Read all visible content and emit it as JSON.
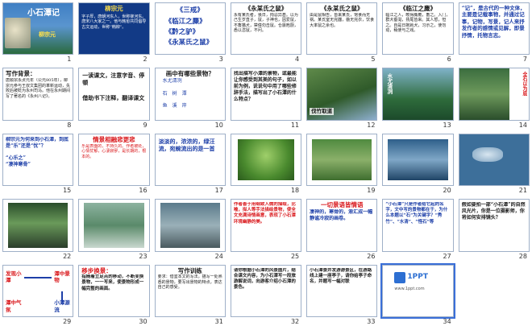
{
  "colors": {
    "border": "#9fb0c8",
    "selection": "#3a6fd8",
    "title_red": "#d9171b",
    "title_blue": "#1d3fa8",
    "dark_blue_bg": "#10307a"
  },
  "slides": [
    {
      "n": "1",
      "title": "小石潭记",
      "author": "柳宗元"
    },
    {
      "n": "2",
      "title": "柳宗元",
      "body": "字子厚，唐朝河东人，世称柳河东。唐宋八大家之一。他与韩愈共同倡导古文运动，世称“韩柳”。"
    },
    {
      "n": "3",
      "lines": [
        "《三戒》",
        "《临江之麋》",
        "《黔之驴》",
        "《永某氏之鼠》"
      ]
    },
    {
      "n": "4",
      "title": "《永某氏之鼠》",
      "body": "永有某氏者，畏日，拘忌异甚。以为己生岁直子，鼠，子神也，因爱鼠，不畜猫犬，禁僮勿击鼠。仓廪庖厨，悉以恣鼠，不问。"
    },
    {
      "n": "5",
      "title": "《永某氏之鼠》",
      "body": "由是鼠相告，皆来某氏，饱食而无祸。某氏室无完器，椸无完衣，饮食大率鼠之余也。"
    },
    {
      "n": "6",
      "title": "《临江之麋》",
      "body": "临江之人，畋得麋麑，畜之。入门，群犬垂涎，扬尾皆来。其人怒，怛之。自是日抱就犬，习示之，使勿动，稍使与之戏。"
    },
    {
      "n": "7",
      "body": "“记”，是古代的一种文体，主要是记载事物，并通过记事，记物，写景，记人来抒发作者的感情或见解，即景抒情，托物言志。"
    },
    {
      "n": "8",
      "title": "写作背景：",
      "body": "唐顺宗永贞元年（公元805年），柳宗元参与王叔文集团的革新运动，失败后被贬为永州司马。他在永州期间写了著名的《永州八记》。"
    },
    {
      "n": "9",
      "body": "一读课文，注意字音、停顿\n\n借助书下注释，翻译课文"
    },
    {
      "n": "10",
      "title": "画中有哪些景物？",
      "body": "水尤清冽\n\n石　树　潭\n\n鱼　溪　岸"
    },
    {
      "n": "11",
      "body": "找出描写小潭的景物，或最能让你感受到其美的句子，如以前为例，说说句中用了哪些修辞手法，描写出了小石潭的什么特点？"
    },
    {
      "n": "12",
      "caption": "伐竹取道"
    },
    {
      "n": "13",
      "caption": "水尤清冽"
    },
    {
      "n": "14",
      "caption": "全石以为底"
    },
    {
      "n": "15",
      "body": "柳宗元为何来到小石潭，到底是“乐”还是“忧”？\n\n“心乐之”\n“凄神寒骨”"
    },
    {
      "n": "16",
      "title": "情景相融悲更悲",
      "body": "乐是表面的，不持久的。作者被贬，心情忧郁，心凄寂寥，是长期的，根本的。"
    },
    {
      "n": "17",
      "body": "淡淡的，浓浓的，绿汪流，宛蜿流出的是一首"
    },
    {
      "n": "18"
    },
    {
      "n": "19"
    },
    {
      "n": "20"
    },
    {
      "n": "21"
    },
    {
      "n": "22"
    },
    {
      "n": "23"
    },
    {
      "n": "24"
    },
    {
      "n": "25",
      "body": "作者善于用细致入微的描绘，比喻，拟人等手法描绘景物，使全文充满诗情画意，表现了小石潭环境幽静的美。"
    },
    {
      "n": "26",
      "title": "一切景语皆情语",
      "body": "凄神的，寒骨的，渐汇成一幅静谧冷寂的画卷。"
    },
    {
      "n": "27",
      "body": "“小石潭”只是作者给它起的名字，文中写的景物都在于，为什么本题以“石”为关键字？“秀竹”、“水清”、“怪石”等"
    },
    {
      "n": "28",
      "body": "假如要拍一部“小石潭”的自然风光片，你是一位摄影师，你将如何安排镜头？"
    },
    {
      "n": "29",
      "lines": [
        "发现小潭",
        "潭中景物",
        "潭中气氛",
        "小潭源流"
      ]
    },
    {
      "n": "30",
      "title": "移步换景：",
      "body": "指随着立足点的移动，不断变换景物，一一写来，使景物形成一幅完整的画面。"
    },
    {
      "n": "31",
      "title": "写作训练",
      "body": "要求：借鉴本文的写法，描写一处熟悉的景物，要写出景物的特点，表达自己的感受。"
    },
    {
      "n": "32",
      "body": "请你根据小石潭的风景图片，结合课文内容，为小石潭写一段旅游解说词，向游客介绍小石潭的景色。"
    },
    {
      "n": "33",
      "body": "小石潭景并发游游景区，在游路线上建一座亭子，请你给亭子命名，并题写一幅对联"
    },
    {
      "n": "34",
      "logo": "1PPT",
      "sub": "www.1ppt.com"
    }
  ]
}
